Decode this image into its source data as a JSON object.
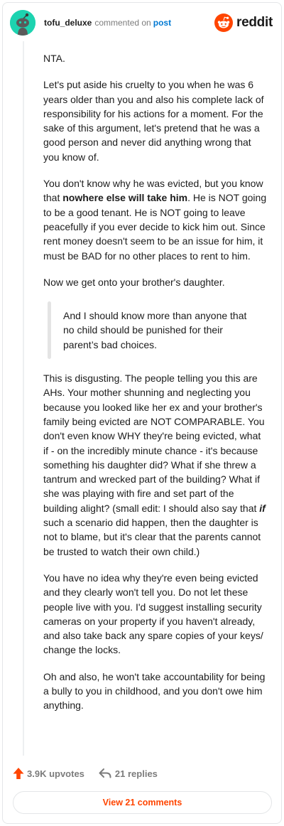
{
  "header": {
    "username": "tofu_deluxe",
    "commented_on": "commented on",
    "post_link": "post",
    "brand_word": "reddit",
    "brand_color": "#ff4500",
    "avatar_color": "#1dd3b0",
    "avatar_icon": "snoo-avatar-icon"
  },
  "comment": {
    "p1": "NTA.",
    "p2": "Let's put aside his cruelty to you when he was 6 years older than you and also his complete lack of responsibility for his actions for a moment. For the sake of this argument, let's pretend that he was a good person and never did anything wrong that you know of.",
    "p3_before": "You don't know why he was evicted, but you know that ",
    "p3_bold": "nowhere else will take him",
    "p3_after": ". He is NOT going to be a good tenant. He is NOT going to leave peacefully if you ever decide to kick him out. Since rent money doesn't seem to be an issue for him, it must be BAD for no other places to rent to him.",
    "p4": "Now we get onto your brother's daughter.",
    "quote": "And I should know more than anyone that no child should be punished for their parent’s bad choices.",
    "p5_before": "This is disgusting. The people telling you this are AHs. Your mother shunning and neglecting you because you looked like her ex and your brother's family being evicted are NOT COMPARABLE. You don't even know WHY they're being evicted, what if - on the incredibly minute chance - it's because something his daughter did? What if she threw a tantrum and wrecked part of the building? What if she was playing with fire and set part of the building alight? (small edit: I should also say that ",
    "p5_emph": "if",
    "p5_after": " such a scenario did happen, then the daughter is not to blame, but it's clear that the parents cannot be trusted to watch their own child.)",
    "p6": "You have no idea why they're even being evicted and they clearly won't tell you. Do not let these people live with you. I'd suggest installing security cameras on your property if you haven't already, and also take back any spare copies of your keys/ change the locks.",
    "p7": "Oh and also, he won't take accountability for being a bully to you in childhood, and you don't owe him anything."
  },
  "footer": {
    "upvotes": "3.9K upvotes",
    "replies": "21 replies",
    "upvote_icon": "upvote-arrow-icon",
    "reply_icon": "reply-arrow-icon",
    "upvote_color": "#ff4500"
  },
  "view_comments": "View 21 comments"
}
